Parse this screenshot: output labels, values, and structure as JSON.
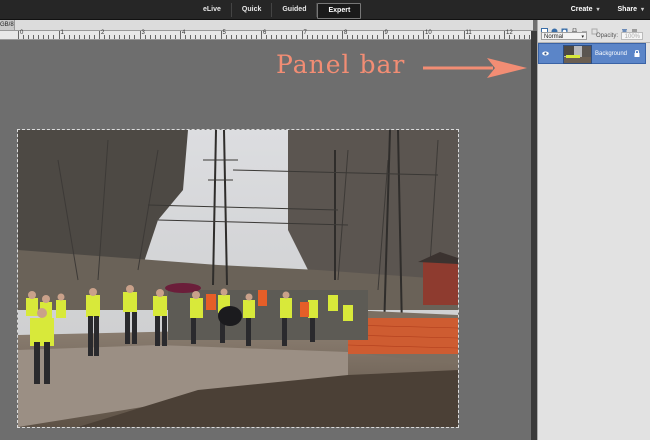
{
  "modes": {
    "elive": "eLive",
    "quick": "Quick",
    "guided": "Guided",
    "expert": "Expert"
  },
  "top_right": {
    "create": "Create",
    "share": "Share"
  },
  "document": {
    "tab_label": "GB/8)"
  },
  "ruler": {
    "labels": [
      "0",
      "1",
      "2",
      "3",
      "4",
      "5",
      "6",
      "7",
      "8",
      "9",
      "10",
      "11",
      "12"
    ]
  },
  "annotation": {
    "text": "Panel bar",
    "color": "#f28d74"
  },
  "panel": {
    "blend_mode": "Normal",
    "opacity_label": "Opacity:",
    "opacity_value": "100%",
    "layer_name": "Background",
    "selected_color": "#5b85c8"
  }
}
